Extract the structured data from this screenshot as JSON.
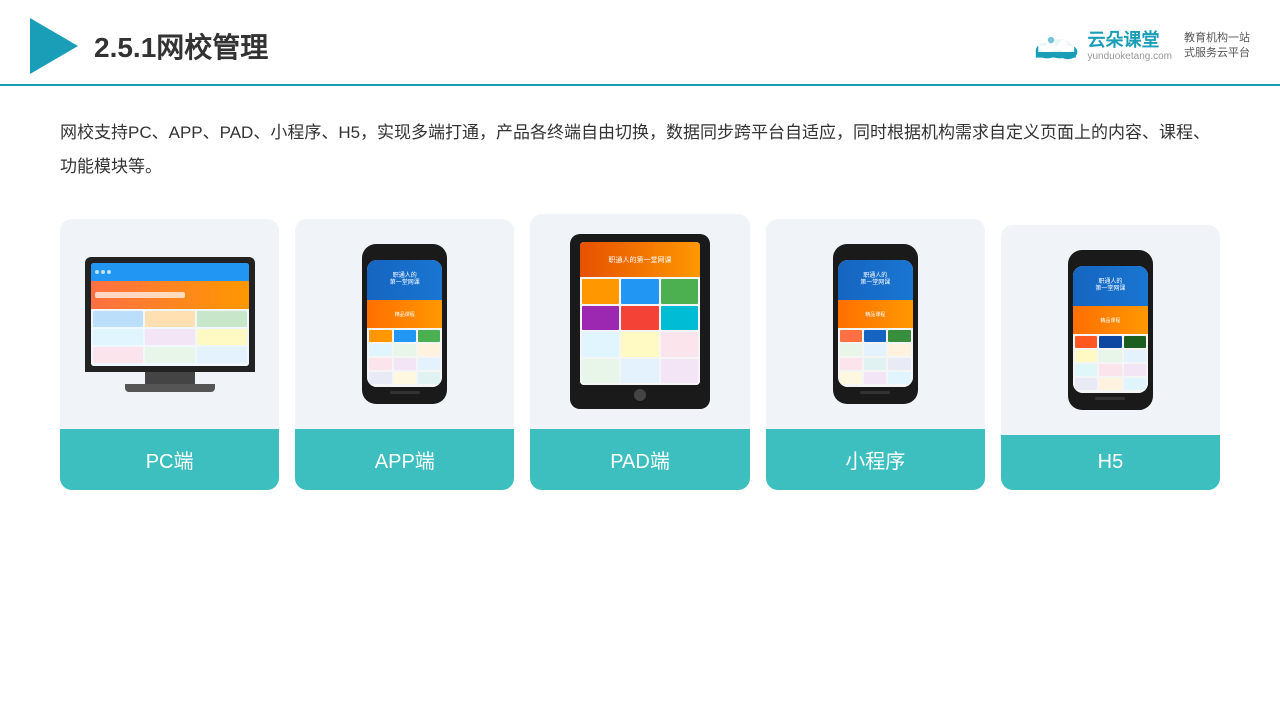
{
  "header": {
    "title": "2.5.1网校管理",
    "brand": {
      "name": "云朵课堂",
      "url": "yunduoketang.com",
      "slogan": "教育机构一站\n式服务云平台"
    }
  },
  "content": {
    "description": "网校支持PC、APP、PAD、小程序、H5，实现多端打通，产品各终端自由切换，数据同步跨平台自适应，同时根据机构需求自定义页面上的内容、课程、功能模块等。"
  },
  "cards": [
    {
      "id": "pc",
      "label": "PC端"
    },
    {
      "id": "app",
      "label": "APP端"
    },
    {
      "id": "pad",
      "label": "PAD端"
    },
    {
      "id": "mini",
      "label": "小程序"
    },
    {
      "id": "h5",
      "label": "H5"
    }
  ]
}
